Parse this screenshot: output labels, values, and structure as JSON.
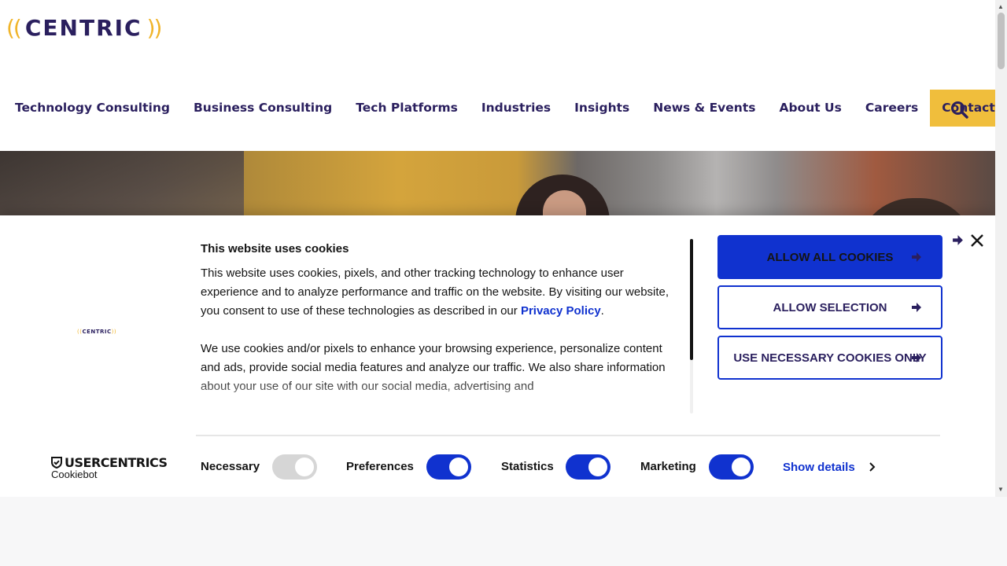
{
  "brand": {
    "logo_left": "((",
    "logo_word": "CENTRIC",
    "logo_right": "))",
    "accent_yellow": "#f0b429",
    "brand_navy": "#2a1f5e"
  },
  "nav": {
    "items": [
      {
        "label": "Technology Consulting"
      },
      {
        "label": "Business Consulting"
      },
      {
        "label": "Tech Platforms"
      },
      {
        "label": "Industries"
      },
      {
        "label": "Insights"
      },
      {
        "label": "News & Events"
      },
      {
        "label": "About Us"
      },
      {
        "label": "Careers"
      },
      {
        "label": "Contact Us"
      }
    ],
    "search_icon": "search-icon"
  },
  "cookie": {
    "title": "This website uses cookies",
    "para1": "This website uses cookies, pixels, and other tracking technology to enhance user experience and to analyze performance and traffic on the website. By visiting our website, you consent to use of these technologies as described in our",
    "privacy_link": "Privacy Policy",
    "para1_end": ".",
    "para2": "We use cookies and/or pixels to enhance your browsing experience, personalize content and ads, provide social media features and analyze our traffic. We also share information about your use of our site with our social media, advertising and",
    "logo_small_left": "((",
    "logo_small_word": "CENTRIC",
    "logo_small_right": "))",
    "buttons": {
      "allow_all": "ALLOW ALL COOKIES",
      "allow_selection": "ALLOW SELECTION",
      "necessary_only": "USE NECESSARY COOKIES ONLY"
    },
    "toggles": [
      {
        "label": "Necessary",
        "on": true,
        "disabled": true
      },
      {
        "label": "Preferences",
        "on": true,
        "disabled": false
      },
      {
        "label": "Statistics",
        "on": true,
        "disabled": false
      },
      {
        "label": "Marketing",
        "on": true,
        "disabled": false
      }
    ],
    "show_details": "Show details",
    "powered_by": {
      "brand": "USERCENTRICS",
      "product": "Cookiebot"
    },
    "accent_blue": "#1032cf"
  }
}
